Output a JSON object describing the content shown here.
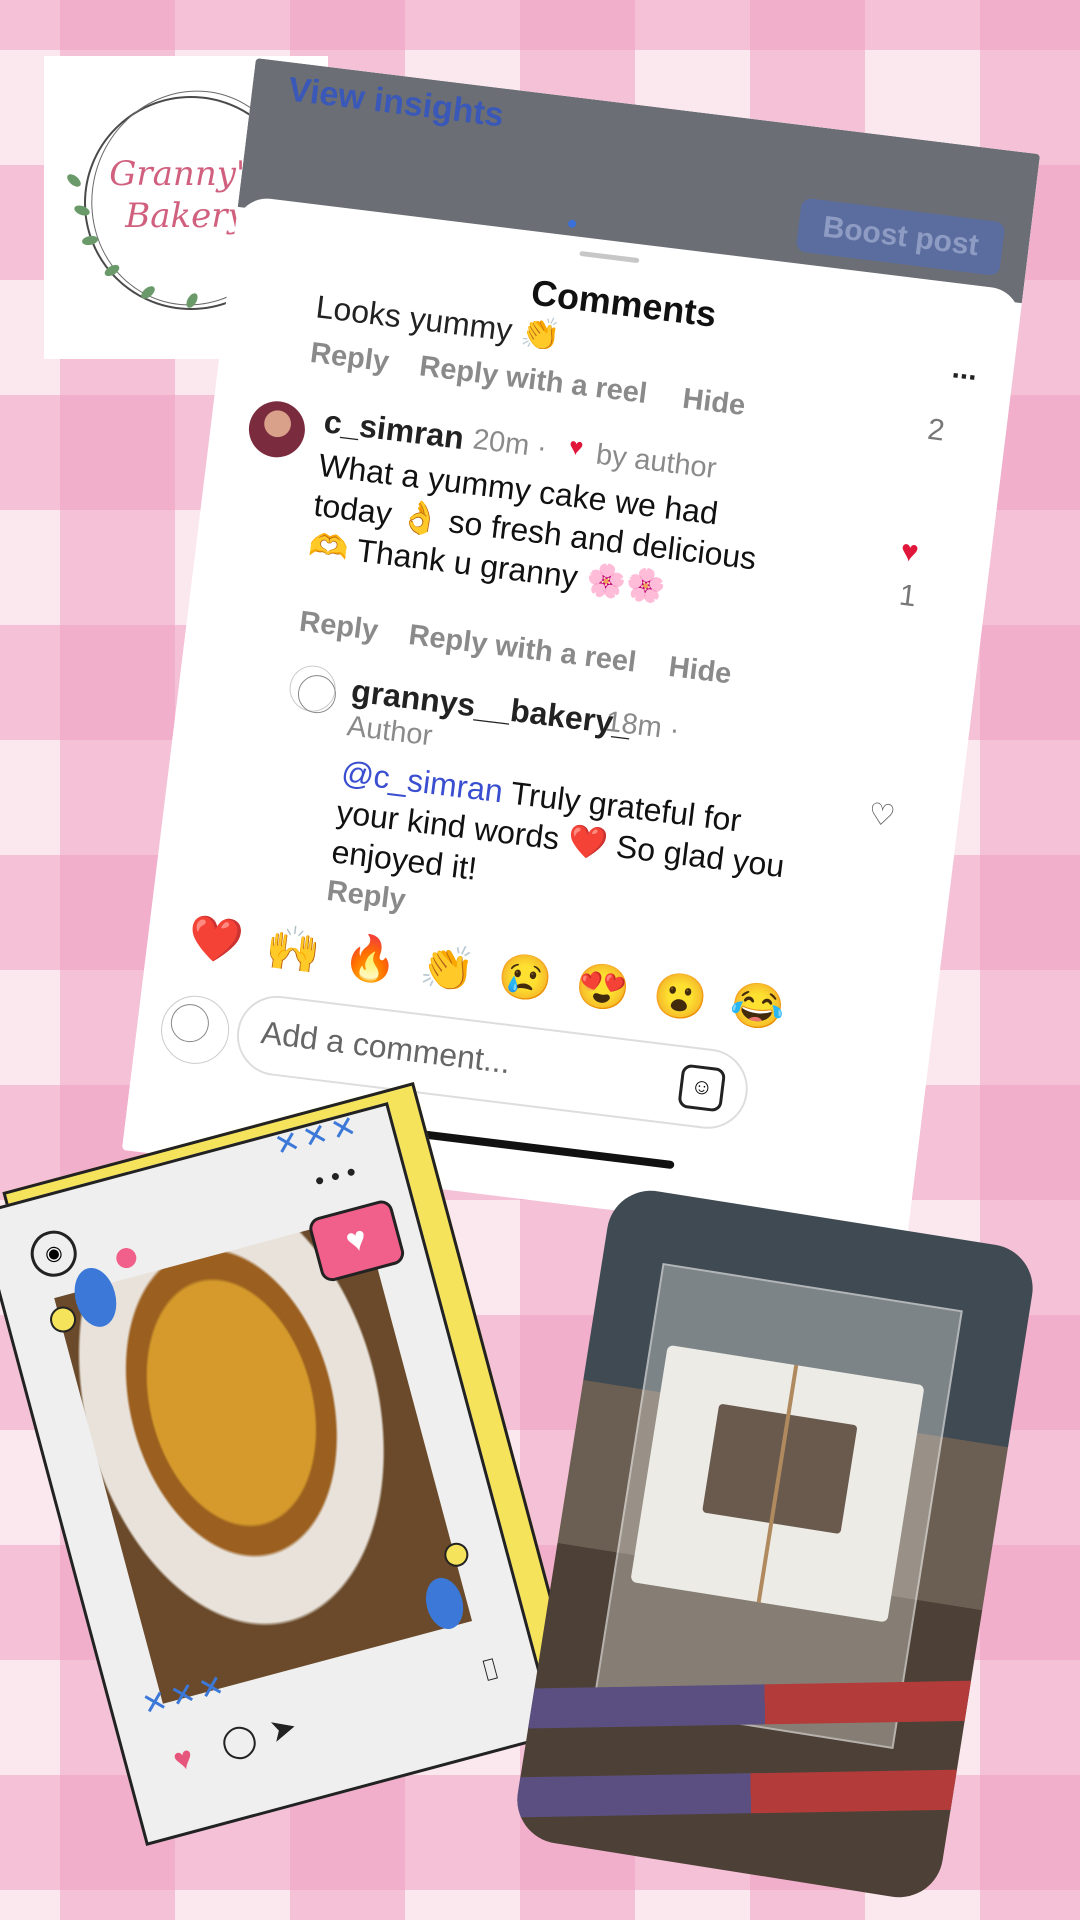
{
  "logo": {
    "line1": "Granny's",
    "line2": "Bakery"
  },
  "screen": {
    "insights_link": "View insights",
    "boost_button": "Boost post",
    "sheet_title": "Comments",
    "more_menu": "...",
    "clipped_comment": "Looks yummy 👏",
    "first_actions": {
      "reply": "Reply",
      "reply_reel": "Reply with a reel",
      "hide": "Hide",
      "count": "2"
    },
    "comment": {
      "username": "c_simran",
      "time": "20m ·",
      "by_author": "by author",
      "text": "What a yummy cake we had today 👌 so fresh and delicious 🫶 Thank u granny 🌸🌸",
      "like_count": "1",
      "actions": {
        "reply": "Reply",
        "reply_reel": "Reply with a reel",
        "hide": "Hide"
      }
    },
    "reply": {
      "username": "grannys__bakery_",
      "time": "18m ·",
      "role": "Author",
      "mention": "@c_simran",
      "text": " Truly grateful for your kind words ❤️ So glad you enjoyed it!",
      "action": "Reply"
    },
    "quick_reactions": [
      "❤️",
      "🙌",
      "🔥",
      "👏",
      "😢",
      "😍",
      "😮",
      "😂"
    ],
    "comment_input": {
      "placeholder": "Add a comment..."
    }
  },
  "icons": {
    "heart_filled": "heart-filled-icon",
    "heart_outline": "heart-outline-icon",
    "sticker": "sticker-icon",
    "profile": "profile-icon",
    "comment": "comment-icon",
    "send": "send-icon",
    "save": "save-icon"
  },
  "colors": {
    "background_check": "#f0a0c3",
    "logo_text": "#d0607e",
    "mention": "#3a4fcf",
    "like_red": "#e0173a",
    "frame_yellow": "#f6e35c"
  }
}
